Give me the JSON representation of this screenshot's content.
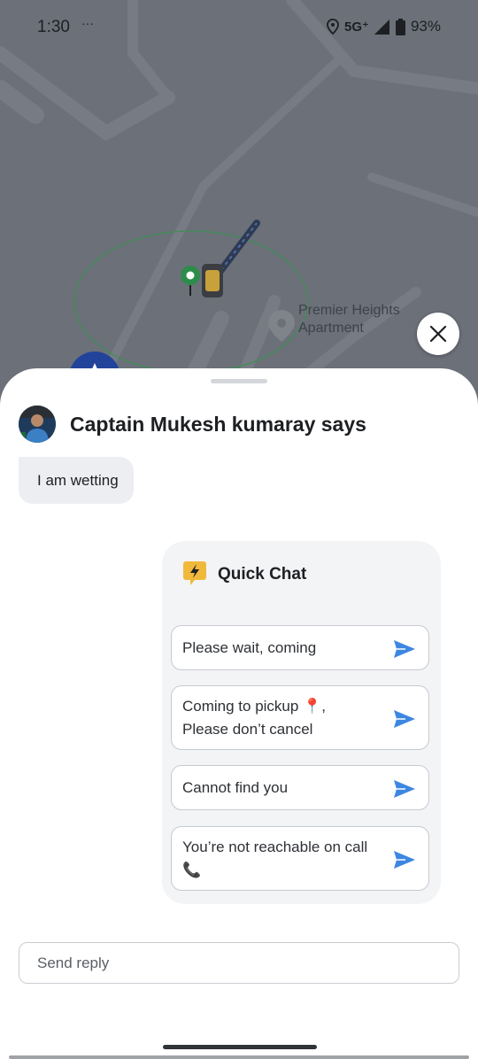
{
  "status_bar": {
    "time": "1:30",
    "dots": "···",
    "network": "5G⁺",
    "battery": "93%"
  },
  "map": {
    "place_label_line1": "Premier Heights",
    "place_label_line2": "Apartment"
  },
  "chat": {
    "captain_title": "Captain Mukesh kumaray says",
    "message": "I am wetting"
  },
  "quick_chat": {
    "title": "Quick Chat",
    "options": [
      {
        "line1": "Please wait, coming",
        "line2": ""
      },
      {
        "line1": "Coming to pickup 📍,",
        "line2": "Please don’t cancel"
      },
      {
        "line1": "Cannot find you",
        "line2": ""
      },
      {
        "line1": "You’re not reachable on call",
        "line2": "📞"
      }
    ]
  },
  "reply": {
    "placeholder": "Send reply"
  },
  "colors": {
    "accent_blue": "#3d87e0",
    "sheet_bg": "#ffffff",
    "panel_bg": "#f3f4f6",
    "map_bg": "#6b7079"
  },
  "icons": [
    "location-icon",
    "signal-icon",
    "battery-icon",
    "close-icon",
    "lightning-chat-icon",
    "send-icon"
  ]
}
